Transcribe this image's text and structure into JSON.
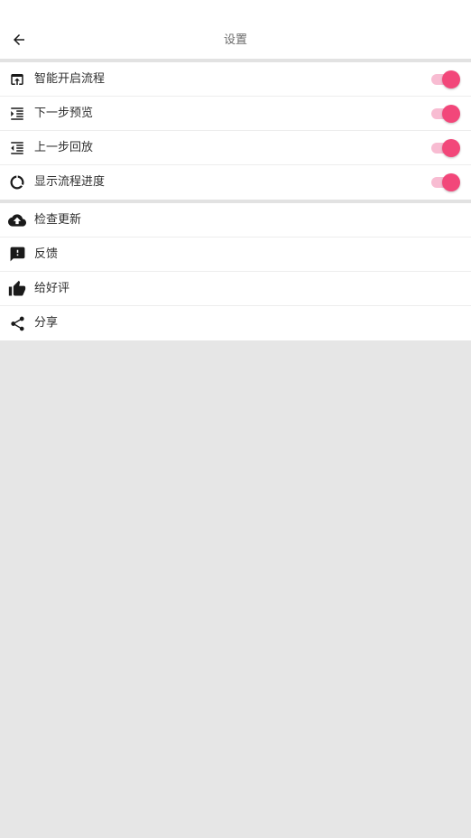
{
  "header": {
    "title": "设置",
    "back_icon": "arrow-left-icon"
  },
  "settings_toggles": [
    {
      "label": "智能开启流程",
      "icon": "open-in-browser-icon",
      "enabled": true
    },
    {
      "label": "下一步预览",
      "icon": "format-indent-increase-icon",
      "enabled": true
    },
    {
      "label": "上一步回放",
      "icon": "format-indent-decrease-icon",
      "enabled": true
    },
    {
      "label": "显示流程进度",
      "icon": "donut-progress-icon",
      "enabled": true
    }
  ],
  "actions": [
    {
      "label": "检查更新",
      "icon": "cloud-upload-icon"
    },
    {
      "label": "反馈",
      "icon": "feedback-icon"
    },
    {
      "label": "给好评",
      "icon": "thumb-up-icon"
    },
    {
      "label": "分享",
      "icon": "share-icon"
    }
  ],
  "colors": {
    "accent": "#f2477a",
    "accent_track": "#f8bcd2",
    "background": "#e6e6e6",
    "surface": "#ffffff"
  }
}
